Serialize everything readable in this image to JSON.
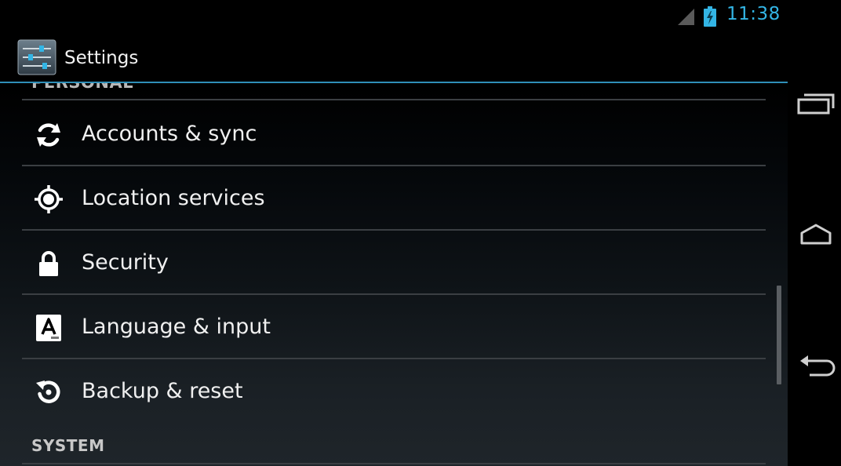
{
  "status_bar": {
    "time": "11:38",
    "signal_icon": "signal-icon",
    "battery_icon": "battery-charging-icon",
    "accent_color": "#33b5e5"
  },
  "action_bar": {
    "title": "Settings",
    "app_icon": "settings-icon"
  },
  "sections": {
    "personal": "PERSONAL",
    "system": "SYSTEM"
  },
  "items": [
    {
      "label": "Accounts & sync",
      "icon": "sync-icon"
    },
    {
      "label": "Location services",
      "icon": "location-icon"
    },
    {
      "label": "Security",
      "icon": "lock-icon"
    },
    {
      "label": "Language & input",
      "icon": "language-icon"
    },
    {
      "label": "Backup & reset",
      "icon": "backup-icon"
    }
  ],
  "nav_bar": {
    "buttons": [
      "recent-apps-icon",
      "home-icon",
      "back-icon"
    ]
  }
}
